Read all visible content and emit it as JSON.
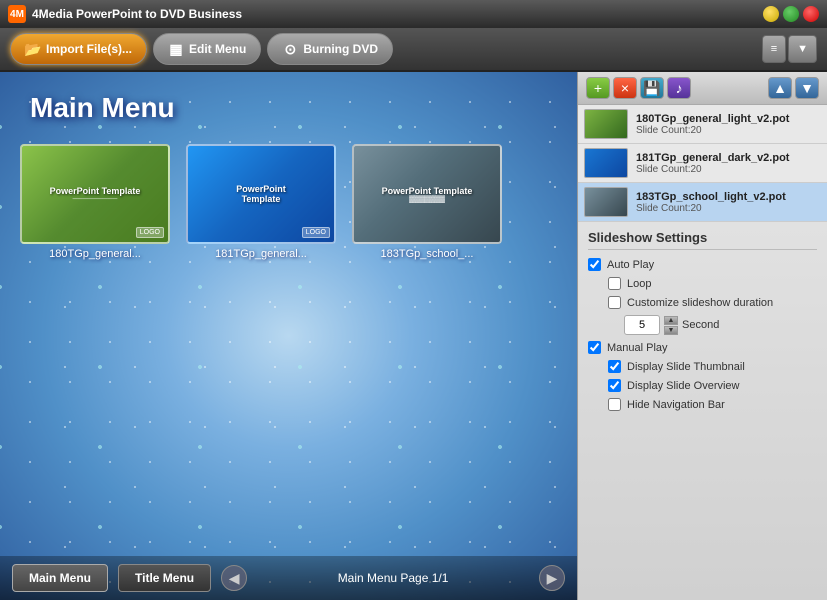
{
  "app": {
    "title": "4Media PowerPoint to DVD Business",
    "icon": "4M"
  },
  "window_controls": {
    "minimize_label": "–",
    "maximize_label": "□",
    "close_label": "×"
  },
  "toolbar": {
    "import_label": "Import File(s)...",
    "edit_menu_label": "Edit Menu",
    "burning_dvd_label": "Burning DVD",
    "list_icon": "≡",
    "dropdown_icon": "▼"
  },
  "preview": {
    "title": "Main Menu",
    "slides": [
      {
        "id": "slide1",
        "thumb_class": "green-pattern",
        "name": "180TGp_general...",
        "ppt_label": "PowerPoint Template"
      },
      {
        "id": "slide2",
        "thumb_class": "blue-ppt",
        "name": "181TGp_general...",
        "ppt_label": "PowerPoint Template"
      },
      {
        "id": "slide3",
        "thumb_class": "school",
        "name": "183TGp_school_...",
        "ppt_label": "PowerPoint Template"
      }
    ]
  },
  "bottom_controls": {
    "main_menu_label": "Main Menu",
    "title_menu_label": "Title Menu",
    "page_info": "Main Menu Page 1/1"
  },
  "list_toolbar": {
    "add_icon": "+",
    "remove_icon": "×",
    "save_icon": "💾",
    "music_icon": "♪",
    "up_icon": "▲",
    "down_icon": "▼"
  },
  "templates": [
    {
      "id": "t1",
      "name": "180TGp_general_light_v2.pot",
      "slides": "Slide Count:20",
      "thumb_class": "t1"
    },
    {
      "id": "t2",
      "name": "181TGp_general_dark_v2.pot",
      "slides": "Slide Count:20",
      "thumb_class": "t2"
    },
    {
      "id": "t3",
      "name": "183TGp_school_light_v2.pot",
      "slides": "Slide Count:20",
      "thumb_class": "t3",
      "selected": true
    }
  ],
  "settings": {
    "title": "Slideshow Settings",
    "auto_play_label": "Auto Play",
    "auto_play_checked": true,
    "loop_label": "Loop",
    "loop_checked": false,
    "customize_label": "Customize slideshow duration",
    "customize_checked": false,
    "duration_value": "5",
    "second_label": "Second",
    "manual_play_label": "Manual Play",
    "manual_play_checked": true,
    "display_thumb_label": "Display Slide Thumbnail",
    "display_thumb_checked": true,
    "display_overview_label": "Display Slide Overview",
    "display_overview_checked": true,
    "hide_nav_label": "Hide Navigation Bar",
    "hide_nav_checked": false
  }
}
